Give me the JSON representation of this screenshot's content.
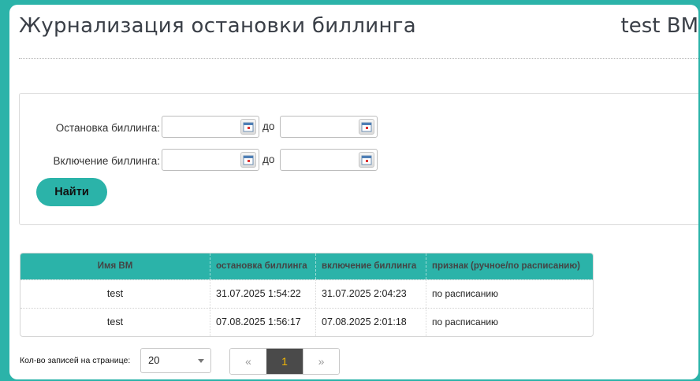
{
  "header": {
    "title": "Журнализация остановки биллинга",
    "vm_name": "test BM"
  },
  "filters": {
    "stop_label": "Остановка биллинга:",
    "start_label": "Включение биллинга:",
    "to_label": "до",
    "find_button": "Найти"
  },
  "table": {
    "columns": [
      "Имя ВМ",
      "остановка биллинга",
      "включение биллинга",
      "признак (ручное/по расписанию)"
    ],
    "rows": [
      [
        "test",
        "31.07.2025 1:54:22",
        "31.07.2025 2:04:23",
        "по расписанию"
      ],
      [
        "test",
        "07.08.2025 1:56:17",
        "07.08.2025 2:01:18",
        "по расписанию"
      ]
    ]
  },
  "pagination": {
    "per_page_label": "Кол-во записей на странице:",
    "per_page_value": "20",
    "prev": "«",
    "current": "1",
    "next": "»"
  },
  "colors": {
    "accent": "#2bb3a9",
    "current_page_bg": "#4a4a4a",
    "current_page_text": "#f2b705"
  }
}
